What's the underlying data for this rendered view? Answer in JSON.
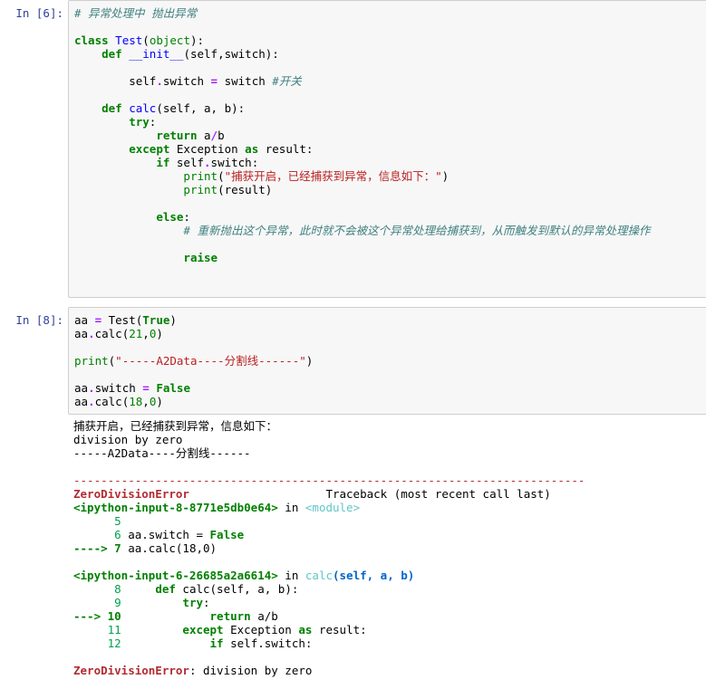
{
  "cell1": {
    "prompt": "In  [6]:",
    "lines": [
      "# 异常处理中 抛出异常",
      "",
      "class Test(object):",
      "    def __init__(self,switch):",
      "",
      "        self.switch = switch #开关",
      "",
      "    def calc(self, a, b):",
      "        try:",
      "            return a/b",
      "        except Exception as result:",
      "            if self.switch:",
      "                print(\"捕获开启，已经捕获到异常，信息如下：\")",
      "                print(result)",
      "",
      "            else:",
      "                # 重新抛出这个异常，此时就不会被这个异常处理给捕获到，从而触发到默认的异常处理操作",
      "",
      "                raise"
    ]
  },
  "cell2": {
    "prompt": "In  [8]:",
    "lines": [
      "aa = Test(True)",
      "aa.calc(21,0)",
      "",
      "print(\"-----A2Data----分割线------\")",
      "",
      "aa.switch = False",
      "aa.calc(18,0)"
    ],
    "stdout": [
      "捕获开启，已经捕获到异常，信息如下：",
      "division by zero",
      "-----A2Data----分割线------"
    ],
    "traceback": {
      "separator": "---------------------------------------------------------------------------",
      "error_name": "ZeroDivisionError",
      "header_right": "Traceback (most recent call last)",
      "frame1_loc": "<ipython-input-8-8771e5db0e64>",
      "frame1_in": " in ",
      "frame1_module": "<module>",
      "frame1_lines": [
        {
          "num": "      5",
          "code": ""
        },
        {
          "num": "      6",
          "code": " aa.switch = False"
        },
        {
          "num": "----> 7",
          "code": " aa.calc(18,0)"
        }
      ],
      "frame2_loc": "<ipython-input-6-26685a2a6614>",
      "frame2_in": " in ",
      "frame2_func": "calc",
      "frame2_args": "(self, a, b)",
      "frame2_lines": [
        {
          "num": "      8",
          "code": "     def calc(self, a, b):"
        },
        {
          "num": "      9",
          "code": "         try:"
        },
        {
          "num": "---> 10",
          "code": "             return a/b"
        },
        {
          "num": "     11",
          "code": "         except Exception as result:"
        },
        {
          "num": "     12",
          "code": "             if self.switch:"
        }
      ],
      "final_error": "ZeroDivisionError",
      "final_msg": ": division by zero"
    }
  }
}
